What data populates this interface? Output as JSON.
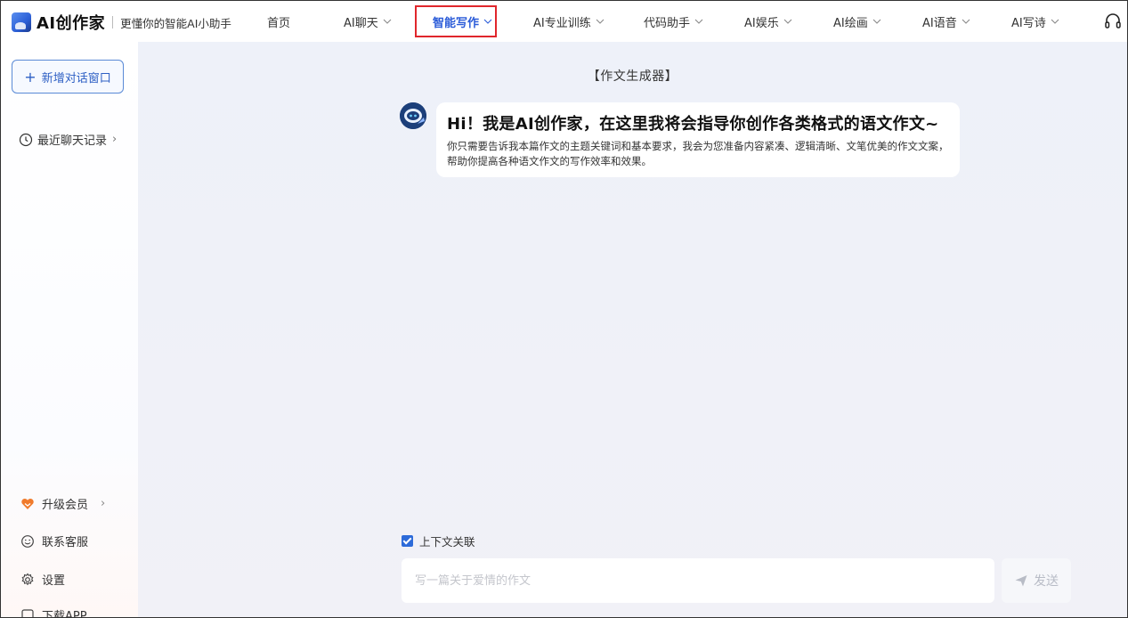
{
  "header": {
    "brand": "AI创作家",
    "slogan": "更懂你的智能AI小助手",
    "nav": [
      {
        "label": "首页",
        "has_dropdown": false
      },
      {
        "label": "AI聊天",
        "has_dropdown": true
      },
      {
        "label": "智能写作",
        "has_dropdown": true,
        "active": true
      },
      {
        "label": "AI专业训练",
        "has_dropdown": true
      },
      {
        "label": "代码助手",
        "has_dropdown": true
      },
      {
        "label": "AI娱乐",
        "has_dropdown": true
      },
      {
        "label": "AI绘画",
        "has_dropdown": true
      },
      {
        "label": "AI语音",
        "has_dropdown": true
      },
      {
        "label": "AI写诗",
        "has_dropdown": true
      }
    ],
    "highlight_color": "#e0262c",
    "support_icon": "headset-icon"
  },
  "sidebar": {
    "new_chat_label": "新增对话窗口",
    "recent_label": "最近聊天记录",
    "bottom_items": [
      {
        "label": "升级会员",
        "icon": "vip-heart-icon"
      },
      {
        "label": "联系客服",
        "icon": "smile-icon"
      },
      {
        "label": "设置",
        "icon": "gear-icon"
      },
      {
        "label": "下载APP",
        "icon": "download-icon"
      }
    ]
  },
  "main": {
    "tool_title": "【作文生成器】",
    "greeting": {
      "title": "Hi！我是AI创作家，在这里我将会指导你创作各类格式的语文作文~",
      "body": "你只需要告诉我本篇作文的主题关键词和基本要求，我会为您准备内容紧凑、逻辑清晰、文笔优美的作文文案，帮助你提高各种语文作文的写作效率和效果。"
    },
    "context_label": "上下文关联",
    "context_checked": true,
    "input_placeholder": "写一篇关于爱情的作文",
    "send_label": "发送"
  },
  "colors": {
    "accent": "#2a5bd8",
    "checkbox": "#2d6bd9",
    "vip": "#f07b2c"
  }
}
